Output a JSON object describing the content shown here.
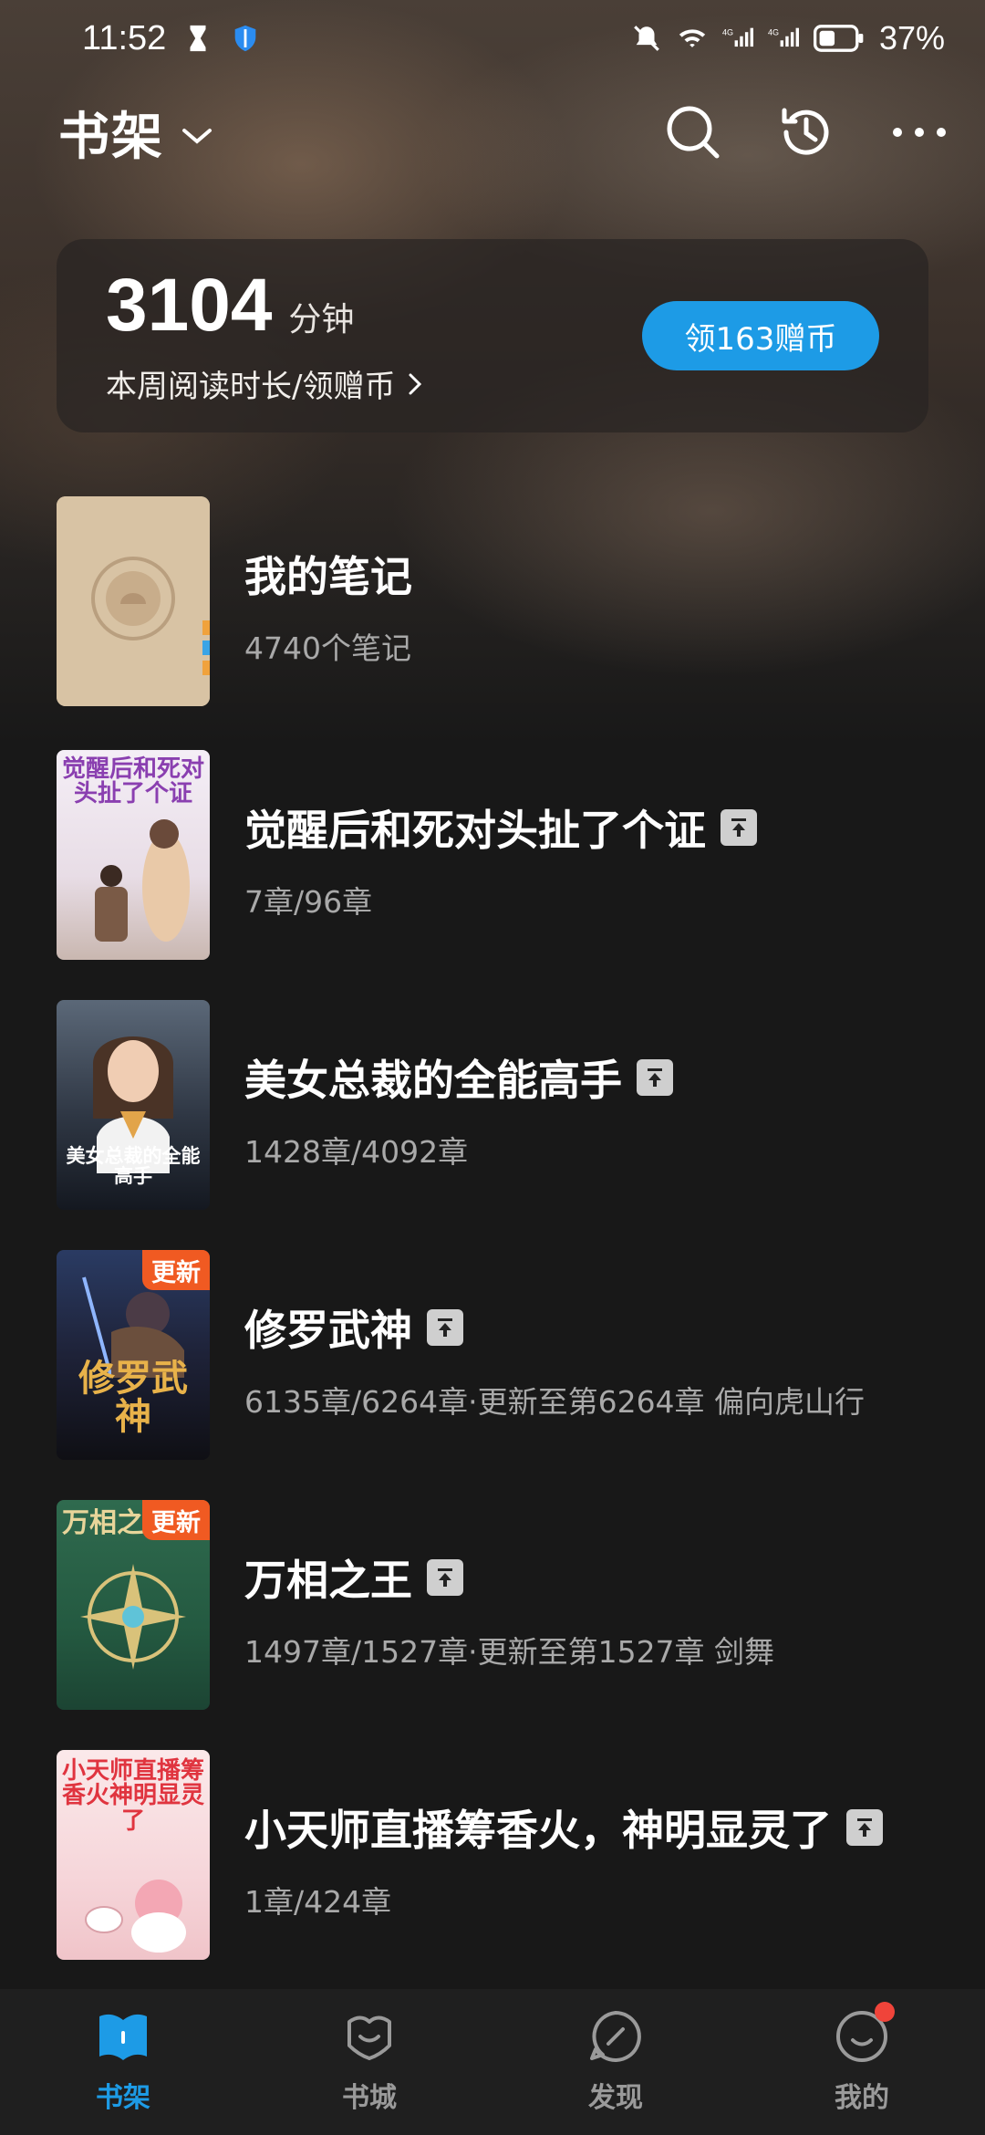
{
  "status_bar": {
    "time": "11:52",
    "battery": "37%"
  },
  "header": {
    "title": "书架"
  },
  "reading": {
    "minutes": "3104",
    "unit": "分钟",
    "subtitle": "本周阅读时长/领赠币",
    "reward_button": "领163赠币"
  },
  "shelf": {
    "items": [
      {
        "title": "我的笔记",
        "meta": "4740个笔记"
      },
      {
        "title": "觉醒后和死对头扯了个证",
        "meta": "7章/96章",
        "cover_text": "觉醒后和死对头扯了个证"
      },
      {
        "title": "美女总裁的全能高手",
        "meta": "1428章/4092章",
        "cover_text": "美女总裁的全能高手"
      },
      {
        "title": "修罗武神",
        "meta": "6135章/6264章·更新至第6264章 偏向虎山行",
        "badge": "更新",
        "cover_text": "修罗武神"
      },
      {
        "title": "万相之王",
        "meta": "1497章/1527章·更新至第1527章 剑舞",
        "badge": "更新",
        "cover_text": "万相之王"
      },
      {
        "title": "小天师直播筹香火，神明显灵了",
        "meta": "1章/424章",
        "cover_text": "小天师直播筹香火神明显灵了"
      }
    ]
  },
  "tabbar": {
    "tabs": [
      {
        "label": "书架",
        "active": true
      },
      {
        "label": "书城"
      },
      {
        "label": "发现"
      },
      {
        "label": "我的",
        "dot": true
      }
    ]
  },
  "colors": {
    "accent": "#1d9be6",
    "update_badge": "#f05a22",
    "background": "#181818"
  }
}
